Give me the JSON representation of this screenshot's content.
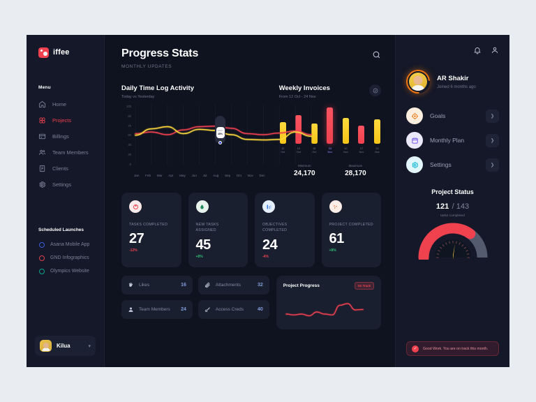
{
  "sidebar": {
    "logo": {
      "text": "iffee",
      "icon": "logo-mark",
      "color": "#f0414f"
    },
    "menu_label": "Menu",
    "items": [
      {
        "label": "Home",
        "icon": "home-icon",
        "active": false
      },
      {
        "label": "Projects",
        "icon": "projects-icon",
        "active": true
      },
      {
        "label": "Billings",
        "icon": "billings-icon",
        "active": false
      },
      {
        "label": "Team Members",
        "icon": "team-members-icon",
        "active": false
      },
      {
        "label": "Clients",
        "icon": "clients-icon",
        "active": false
      },
      {
        "label": "Settings",
        "icon": "settings-icon",
        "active": false
      }
    ],
    "scheduled_label": "Scheduled Launches",
    "scheduled": [
      {
        "label": "Asana Mobile App",
        "color": "#3b5bdb"
      },
      {
        "label": "GND Infographics",
        "color": "#e0434f"
      },
      {
        "label": "Olympics Website",
        "color": "#13a08a"
      }
    ],
    "user": {
      "name": "Kilua",
      "chevron": "chevron-down-icon"
    }
  },
  "header": {
    "title": "Progress Stats",
    "subtitle": "MONTHLY UPDATES",
    "search_icon": "search-icon"
  },
  "chart_data": [
    {
      "type": "line",
      "title": "Daily Time Log Activity",
      "subtitle": "Today vs Yesterday",
      "xlabel": "",
      "ylabel": "",
      "ylim": [
        0,
        10
      ],
      "yticks": [
        "10h",
        "8h",
        "7h",
        "6h",
        "4h",
        "2h",
        "0"
      ],
      "categories": [
        "Jan",
        "Feb",
        "Mar",
        "Apr",
        "May",
        "Jun",
        "Jul",
        "Aug",
        "Sep",
        "Oct",
        "Nov",
        "Dec"
      ],
      "series": [
        {
          "name": "Today",
          "color": "#f0414f",
          "values": [
            5.6,
            5.9,
            5.4,
            6.3,
            6.9,
            7.0,
            6.6,
            5.6,
            5.4,
            5.7,
            6.1,
            5.4
          ]
        },
        {
          "name": "Yesterday",
          "color": "#ffd93d",
          "values": [
            5.3,
            6.5,
            6.9,
            5.6,
            6.4,
            6.2,
            5.4,
            4.5,
            4.4,
            4.5,
            5.9,
            5.1
          ]
        }
      ],
      "tooltip": {
        "label": "SPENT",
        "value": "45%",
        "at": "Jul",
        "dot_color": "#3b4ae0"
      }
    },
    {
      "type": "bar",
      "title": "Weekly Invoices",
      "subtitle": "From 12 Oct - 24 Nov",
      "categories": [
        "12 Oct",
        "19 Oct",
        "26 Oct",
        "03 Nov",
        "10 Nov",
        "17 Nov",
        "24 Nov"
      ],
      "values": [
        60,
        78,
        55,
        100,
        72,
        50,
        68
      ],
      "colors": [
        "#ffd93d",
        "#f0414f",
        "#ffd93d",
        "#f0414f",
        "#ffd93d",
        "#f0414f",
        "#ffd93d"
      ],
      "highlight_index": 3,
      "stats": [
        {
          "label": "Minimum",
          "value": "24,170"
        },
        {
          "label": "Maximum",
          "value": "28,170"
        }
      ],
      "action_icon": "message-icon"
    },
    {
      "type": "line",
      "title": "Project Progress",
      "badge": "On Track",
      "values": [
        30,
        26,
        30,
        22,
        40,
        30,
        26,
        72,
        80,
        50,
        52
      ],
      "color": "#f0414f"
    }
  ],
  "stats": [
    {
      "label": "TASKS\nCOMPLETED",
      "value": "27",
      "delta": "-12%",
      "dir": "down",
      "icon": "donut-icon",
      "icon_bg": "#fdeaea",
      "icon_fg": "#f0414f"
    },
    {
      "label": "NEW TASKS\nASSIGNED",
      "value": "45",
      "delta": "+8%",
      "dir": "up",
      "icon": "drop-icon",
      "icon_bg": "#e7f4ee",
      "icon_fg": "#1f8a5a"
    },
    {
      "label": "OBJECTIVES\nCOMPLETED",
      "value": "24",
      "delta": "-4%",
      "dir": "down",
      "icon": "chart-icon",
      "icon_bg": "#e5f0ff",
      "icon_fg": "#3b7ddd"
    },
    {
      "label": "PROJECT\nCOMPLETED",
      "value": "61",
      "delta": "+8%",
      "dir": "up",
      "icon": "dots-icon",
      "icon_bg": "#fdeee7",
      "icon_fg": "#e8622f"
    }
  ],
  "mini_cards": [
    {
      "label": "Likes",
      "value": "16",
      "icon": "clap-icon"
    },
    {
      "label": "Attachments",
      "value": "32",
      "icon": "paperclip-icon"
    },
    {
      "label": "Team Members",
      "value": "24",
      "icon": "person-icon"
    },
    {
      "label": "Access Creds",
      "value": "40",
      "icon": "key-icon"
    }
  ],
  "right": {
    "bell_icon": "bell-icon",
    "account_icon": "account-icon",
    "profile": {
      "name": "AR Shakir",
      "subtitle": "Joined 6 months ago"
    },
    "items": [
      {
        "label": "Goals",
        "icon": "target-icon",
        "bg": "#fdeee0",
        "fg": "#f2760f",
        "arrow": "chevron-right-icon"
      },
      {
        "label": "Monthly Plan",
        "icon": "calendar-icon",
        "bg": "#ece9fd",
        "fg": "#6b4de6",
        "arrow": "chevron-right-icon"
      },
      {
        "label": "Settings",
        "icon": "gear-icon",
        "bg": "#e2f6fb",
        "fg": "#14b8d4",
        "arrow": "chevron-right-icon"
      }
    ],
    "project_status": {
      "title": "Project Status",
      "completed": "121",
      "total": "/ 143",
      "sub": "tasks completed",
      "percent": 70,
      "arc_color": "#f0414f",
      "track_color": "#555b6e",
      "needle_color": "#ffd93d"
    },
    "note": {
      "text": "Good Work. You are on track this month.",
      "icon": "check-icon",
      "color": "#f0414f"
    }
  }
}
